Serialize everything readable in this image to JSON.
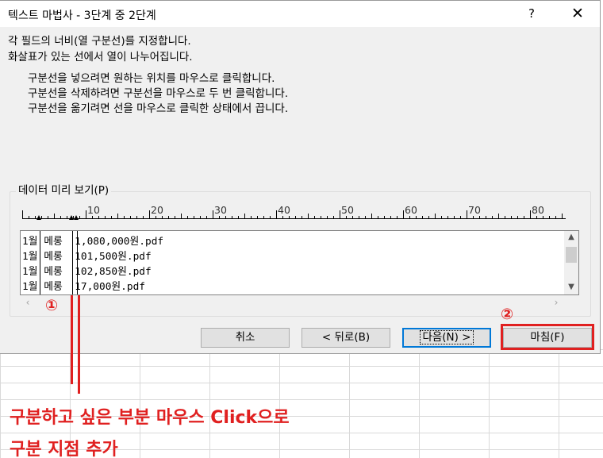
{
  "dialog": {
    "title": "텍스트 마법사 - 3단계 중 2단계",
    "help": "?",
    "close": "✕",
    "instructions": [
      "각 필드의 너비(열 구분선)를 지정합니다.",
      "화살표가 있는 선에서 열이 나누어집니다."
    ],
    "tips": [
      "구분선을 넣으려면 원하는 위치를 마우스로 클릭합니다.",
      "구분선을 삭제하려면 구분선을 마우스로 두 번 클릭합니다.",
      "구분선을 옮기려면 선을 마우스로 클릭한 상태에서 끕니다."
    ],
    "preview_label": "데이터 미리 보기(P)",
    "ruler_labels": [
      "10",
      "20",
      "30",
      "40",
      "50",
      "60",
      "70",
      "80"
    ],
    "preview_rows": [
      {
        "c1": "1월",
        "c2": "메롱",
        "c3": "1,080,000원.pdf"
      },
      {
        "c1": "1월",
        "c2": "메롱",
        "c3": "101,500원.pdf"
      },
      {
        "c1": "1월",
        "c2": "메롱",
        "c3": "102,850원.pdf"
      },
      {
        "c1": "1월",
        "c2": "메롱",
        "c3": "17,000원.pdf"
      }
    ],
    "buttons": {
      "cancel": "취소",
      "back": "< 뒤로(B)",
      "next": "다음(N) >",
      "finish": "마침(F)"
    }
  },
  "annotation": {
    "marker1": "①",
    "marker2": "②",
    "line1": "구분하고 싶은 부분 마우스 Click으로",
    "line2": "구분 지점 추가"
  },
  "colors": {
    "accent": "#e02020",
    "default_button": "#0078d7"
  }
}
